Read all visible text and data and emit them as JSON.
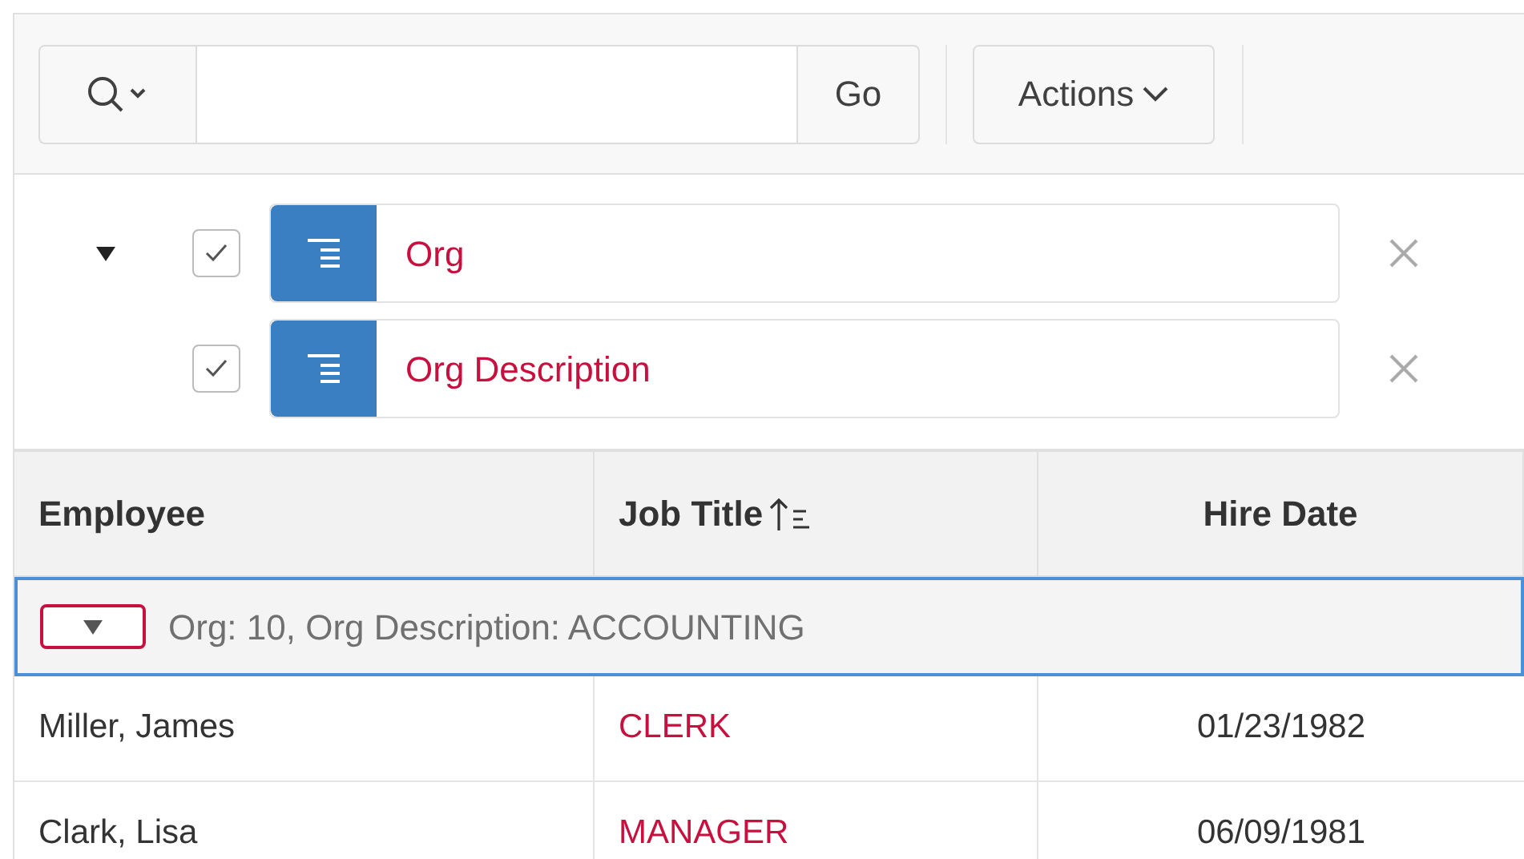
{
  "toolbar": {
    "go_label": "Go",
    "actions_label": "Actions"
  },
  "control_break": {
    "expanded": true,
    "columns": [
      {
        "label": "Org",
        "checked": true
      },
      {
        "label": "Org Description",
        "checked": true
      }
    ]
  },
  "table": {
    "columns": [
      {
        "label": "Employee",
        "sorted": false
      },
      {
        "label": "Job Title",
        "sorted": true
      },
      {
        "label": "Hire Date",
        "sorted": false
      }
    ],
    "group": {
      "label": "Org: 10, Org Description: ACCOUNTING",
      "expanded": true
    },
    "rows": [
      {
        "employee": "Miller, James",
        "job_title": "CLERK",
        "hire_date": "01/23/1982"
      },
      {
        "employee": "Clark, Lisa",
        "job_title": "MANAGER",
        "hire_date": "06/09/1981"
      }
    ]
  }
}
